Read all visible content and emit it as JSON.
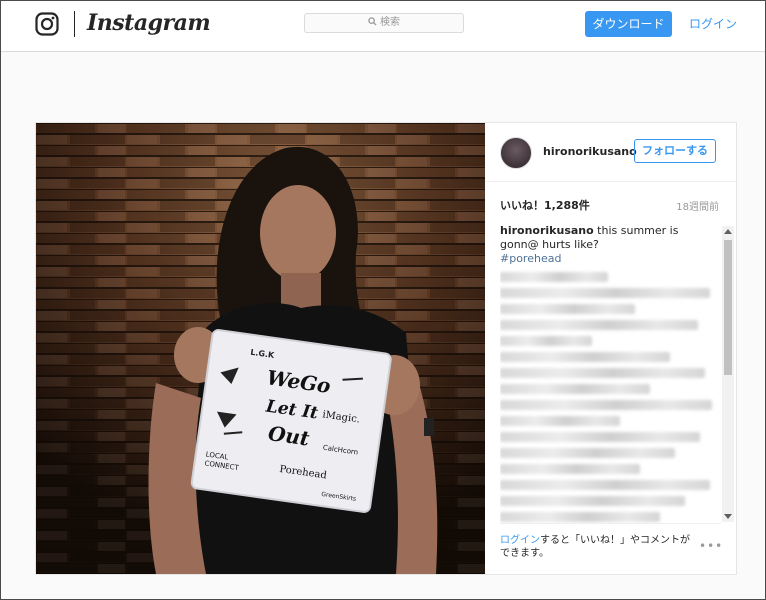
{
  "nav": {
    "brand": "Instagram",
    "search_placeholder": "検索",
    "download_label": "ダウンロード",
    "login_label": "ログイン",
    "accent_color": "#3897f0"
  },
  "post": {
    "username": "hironorikusano",
    "follow_label": "フォローする",
    "likes": "いいね！1,288件",
    "time_ago": "18週間前",
    "caption_user": "hironorikusano",
    "caption_text": " this summer is gonn@ hurts like?",
    "hashtag": "#porehead",
    "login_link": "ログイン",
    "login_text": "すると「いいね！」やコメントができます。",
    "more_label": "•••",
    "photo": {
      "towel_text": [
        "L.G.K",
        "WeGo",
        "Let It",
        "Out",
        "iMagic.",
        "Porehead",
        "LOCAL CONNECT",
        "CalcHcorn",
        "GreenSkirts"
      ]
    }
  }
}
